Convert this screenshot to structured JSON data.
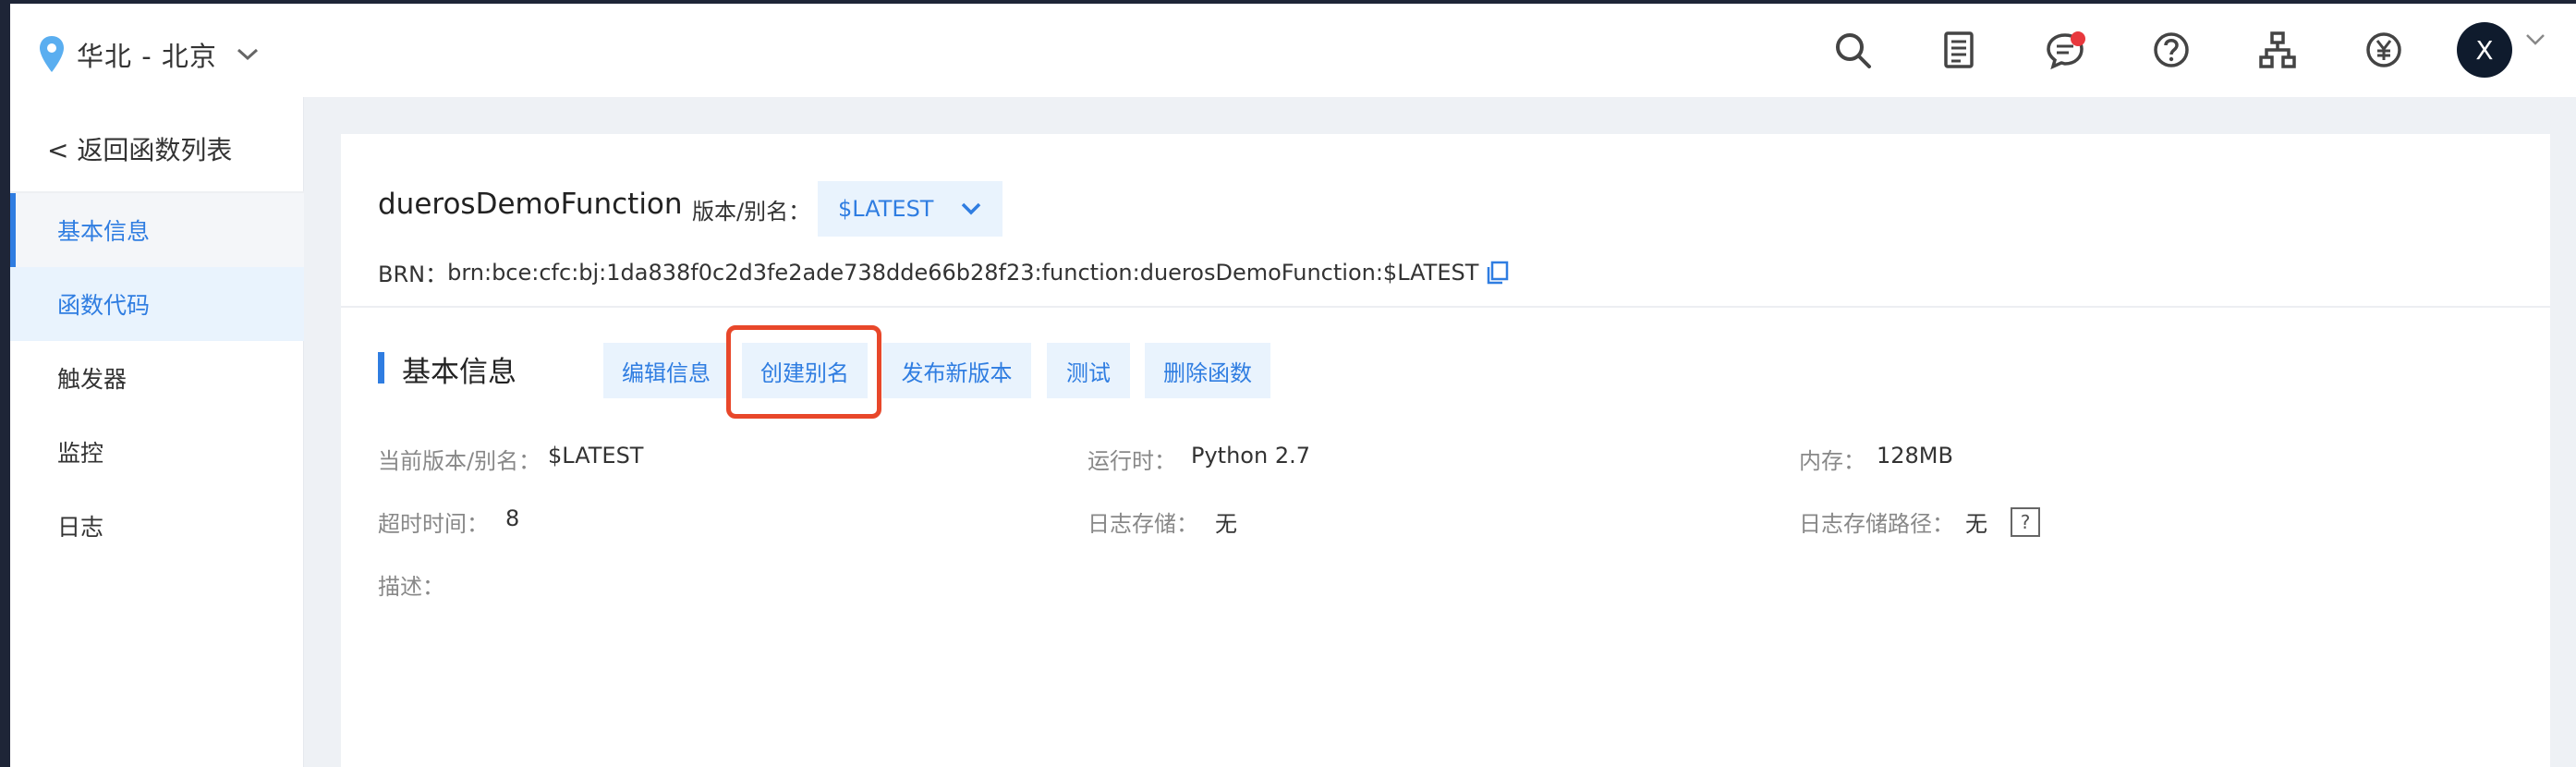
{
  "header": {
    "region": "华北 - 北京",
    "avatar_initial": "X",
    "icons": [
      "search-icon",
      "document-list-icon",
      "message-icon",
      "help-circle-icon",
      "org-chart-icon",
      "yen-icon"
    ],
    "notification_color": "#e8383d"
  },
  "sidebar": {
    "back_label": "< 返回函数列表",
    "items": [
      {
        "label": "基本信息"
      },
      {
        "label": "函数代码"
      },
      {
        "label": "触发器"
      },
      {
        "label": "监控"
      },
      {
        "label": "日志"
      }
    ]
  },
  "function": {
    "name": "duerosDemoFunction",
    "version_label": "版本/别名：",
    "version_value": "$LATEST",
    "brn_label": "BRN：",
    "brn_value": "brn:bce:cfc:bj:1da838f0c2d3fe2ade738dde66b28f23:function:duerosDemoFunction:$LATEST"
  },
  "section": {
    "title": "基本信息",
    "actions": [
      {
        "label": "编辑信息"
      },
      {
        "label": "创建别名"
      },
      {
        "label": "发布新版本"
      },
      {
        "label": "测试"
      },
      {
        "label": "删除函数"
      }
    ]
  },
  "info": {
    "current_version_label": "当前版本/别名：",
    "current_version_value": "$LATEST",
    "runtime_label": "运行时：",
    "runtime_value": "Python 2.7",
    "memory_label": "内存：",
    "memory_value": "128MB",
    "timeout_label": "超时时间：",
    "timeout_value": "8",
    "log_storage_label": "日志存储：",
    "log_storage_value": "无",
    "log_path_label": "日志存储路径：",
    "log_path_value": "无",
    "help_symbol": "?",
    "description_label": "描述："
  },
  "colors": {
    "accent": "#2f7de1",
    "accent_bg": "#e9f3fd",
    "highlight": "#e8472a"
  }
}
